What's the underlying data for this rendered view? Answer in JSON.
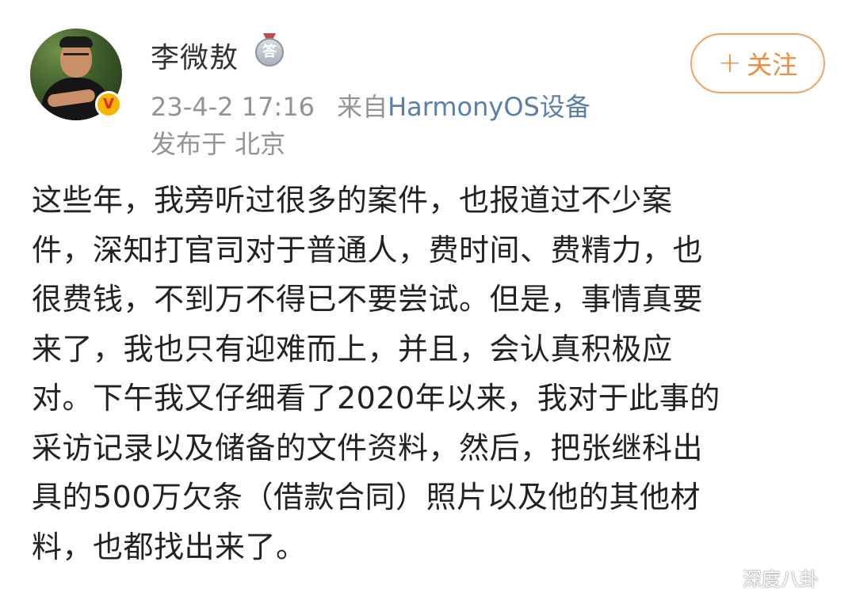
{
  "post": {
    "username": "李微敖",
    "verified_badge_label": "V",
    "medal_label": "答",
    "timestamp": "23-4-2 17:16",
    "source_prefix": "来自",
    "source_name": "HarmonyOS设备",
    "location": "发布于 北京",
    "follow_button": {
      "plus": "+",
      "label": "关注"
    },
    "content_lines": [
      "这些年，我旁听过很多的案件，也报道过不少案",
      "件，深知打官司对于普通人，费时间、费精力，也",
      "很费钱，不到万不得已不要尝试。但是，事情真要",
      "来了，我也只有迎难而上，并且，会认真积极应",
      "对。下午我又仔细看了2020年以来，我对于此事的",
      "采访记录以及储备的文件资料，然后，把张继科出",
      "具的500万欠条（借款合同）照片以及他的其他材",
      "料，也都找出来了。"
    ]
  },
  "watermark": {
    "text": "深度八卦",
    "icon": "wechat-icon"
  },
  "colors": {
    "username": "#333333",
    "meta": "#939393",
    "source_link": "#5b7fa8",
    "follow_accent": "#ef8b3b",
    "body_text": "#222222",
    "verified_badge": "#f7b500"
  }
}
